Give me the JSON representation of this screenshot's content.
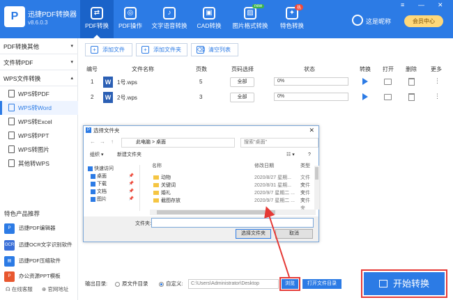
{
  "app": {
    "name": "迅捷PDF转换器",
    "version": "v8.6.0.3",
    "logo_letter": "P"
  },
  "nav": [
    {
      "label": "PDF转换",
      "icon": "convert-icon",
      "glyph": "⇄"
    },
    {
      "label": "PDF操作",
      "icon": "pdf-ops-icon",
      "glyph": "◎"
    },
    {
      "label": "文字语音转换",
      "icon": "audio-icon",
      "glyph": "♪"
    },
    {
      "label": "CAD转换",
      "icon": "cad-icon",
      "glyph": "▣"
    },
    {
      "label": "图片格式转换",
      "icon": "image-icon",
      "glyph": "▨",
      "badge": "new"
    },
    {
      "label": "特色转换",
      "icon": "special-icon",
      "glyph": "✦",
      "badge": "热"
    }
  ],
  "user": {
    "name": "这是昵称",
    "vip_label": "会员中心"
  },
  "window": {
    "menu": "≡",
    "minimize": "—",
    "close": "✕"
  },
  "sidebar": {
    "groups": [
      {
        "label": "PDF转换其他"
      },
      {
        "label": "文件转PDF"
      },
      {
        "label": "WPS文件转换"
      }
    ],
    "items": [
      {
        "label": "WPS转PDF"
      },
      {
        "label": "WPS转Word"
      },
      {
        "label": "WPS转Excel"
      },
      {
        "label": "WPS转PPT"
      },
      {
        "label": "WPS转图片"
      },
      {
        "label": "其他转WPS"
      }
    ],
    "featured_title": "特色产品推荐",
    "featured": [
      {
        "label": "迅捷PDF编辑器",
        "color": "#2c7be5",
        "glyph": "P"
      },
      {
        "label": "迅捷OCR文字识别软件",
        "color": "#3a6fd8",
        "glyph": "OCR"
      },
      {
        "label": "迅捷PDF压缩软件",
        "color": "#2c7be5",
        "glyph": "▤"
      },
      {
        "label": "办公资源PPT模板",
        "color": "#e8572f",
        "glyph": "P"
      }
    ],
    "footer": {
      "service": "在线客服",
      "website": "官网地址"
    }
  },
  "toolbar": {
    "add_file": "添加文件",
    "add_folder": "添加文件夹",
    "clear_list": "清空列表"
  },
  "table": {
    "headers": {
      "index": "编号",
      "name": "文件名称",
      "pages": "页数",
      "page_select": "页码选择",
      "status": "状态",
      "convert": "转换",
      "open": "打开",
      "delete": "删除",
      "more": "更多"
    },
    "rows": [
      {
        "index": "1",
        "name": "1号.wps",
        "pages": "5",
        "page_select": "全部",
        "progress": "0%"
      },
      {
        "index": "2",
        "name": "2号.wps",
        "pages": "3",
        "page_select": "全部",
        "progress": "0%"
      }
    ]
  },
  "dialog": {
    "title": "选择文件夹",
    "path": [
      "此电脑",
      "桌面"
    ],
    "search_placeholder": "搜索\"桌面\"",
    "organize": "组织 ▾",
    "new_folder": "新建文件夹",
    "nav_items": [
      {
        "label": "快速访问"
      },
      {
        "label": "桌面"
      },
      {
        "label": "下载"
      },
      {
        "label": "文档"
      },
      {
        "label": "图片"
      }
    ],
    "columns": {
      "name": "名称",
      "modified": "修改日期",
      "type": "类型"
    },
    "files": [
      {
        "name": "动物",
        "modified": "2020/8/27 星期...",
        "type": "文件夹"
      },
      {
        "name": "关键词",
        "modified": "2020/8/31 星期...",
        "type": "文件夹"
      },
      {
        "name": "婚礼",
        "modified": "2020/9/7 星期二 ...",
        "type": "文件夹"
      },
      {
        "name": "截图存放",
        "modified": "2020/9/7 星期二 ...",
        "type": "文件夹"
      }
    ],
    "folder_label": "文件夹:",
    "select_button": "选择文件夹",
    "cancel_button": "取消"
  },
  "output": {
    "label": "输出目录:",
    "option_source": "原文件目录",
    "option_custom": "自定义:",
    "path": "C:\\Users\\Administrator\\Desktop",
    "browse": "浏览",
    "open_dir": "打开文件目录",
    "start": "开始转换"
  },
  "colors": {
    "brand": "#2c7be5",
    "highlight": "#e53935"
  }
}
